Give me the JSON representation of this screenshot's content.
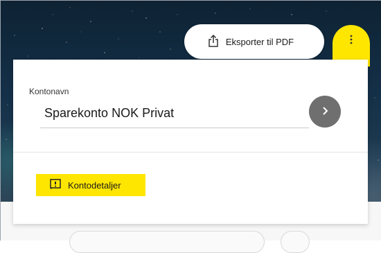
{
  "colors": {
    "accent": "#ffe600",
    "go_button": "#6f6f6f",
    "card": "#ffffff"
  },
  "header": {
    "export_button": {
      "label": "Eksporter til PDF",
      "icon": "share-upload-icon"
    },
    "more_button": {
      "icon": "vertical-dots-icon"
    }
  },
  "account": {
    "field_label": "Kontonavn",
    "field_value": "Sparekonto NOK Privat",
    "go_button_icon": "chevron-right-icon"
  },
  "details_button": {
    "label": "Kontodetaljer",
    "icon": "info-box-icon"
  }
}
